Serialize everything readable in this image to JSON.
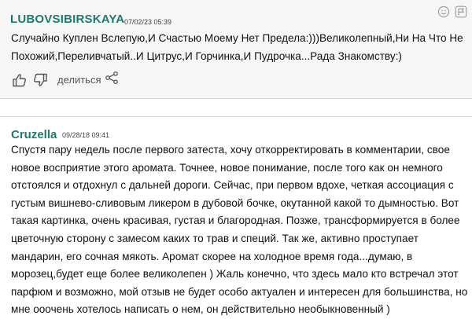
{
  "reviews": [
    {
      "author": "LUBOVSIBIRSKAYA",
      "date": "07/02/23 05:39",
      "lines": [
        "Случайно Куплен Вслепую,И Счастью Моему Нет Предела:)))Великолепный,Ни На Что Не",
        "Похожий,Переливчатый..И Цитрус,И Горчинка,И Пудрочка...Рада Знакомству:)"
      ],
      "share_label": "делиться"
    },
    {
      "author": "Cruzella",
      "date": "09/28/18 09:41",
      "lines": [
        "Спустя пару недель после первого затеста, хочу откорректировать в комментарии, свое",
        "новое восприятие этого аромата. Точнее, новое понимание, после того как он немного",
        "отстоялся и отдохнул с дальней дороги. Сейчас, при первом вдохе, четкая ассоциация с",
        "густым вишнево-сливовым ликером в дубовой бочке, окутанной какой то дымностью. Вот",
        "такая картинка, очень красивая, густая и благородная. Позже, трансформируется в более",
        "цветочную сторону с замесом каких то трав и специй. Так же, активно проступает",
        "мандарин, его сочная мякоть. Аромат скорее на холодное время года...думаю, в",
        "морозец,будет еще более великолепен ) Жаль конечно, что здесь мало кто встречал этот",
        "парфюм и возможно, мой отзыв не будет особо актуален и интересен для большинства, но",
        "мне ооочень хотелось написать о нем, он действительно необыкновенный )"
      ]
    }
  ],
  "icons": {
    "smiley": "smiley-icon",
    "flag": "flag-icon",
    "thumbs_up": "thumbs-up-icon",
    "thumbs_down": "thumbs-down-icon",
    "share": "share-icon"
  },
  "colors": {
    "author": "#1f7a6e",
    "first_review_bg": "#f6f6f6"
  }
}
